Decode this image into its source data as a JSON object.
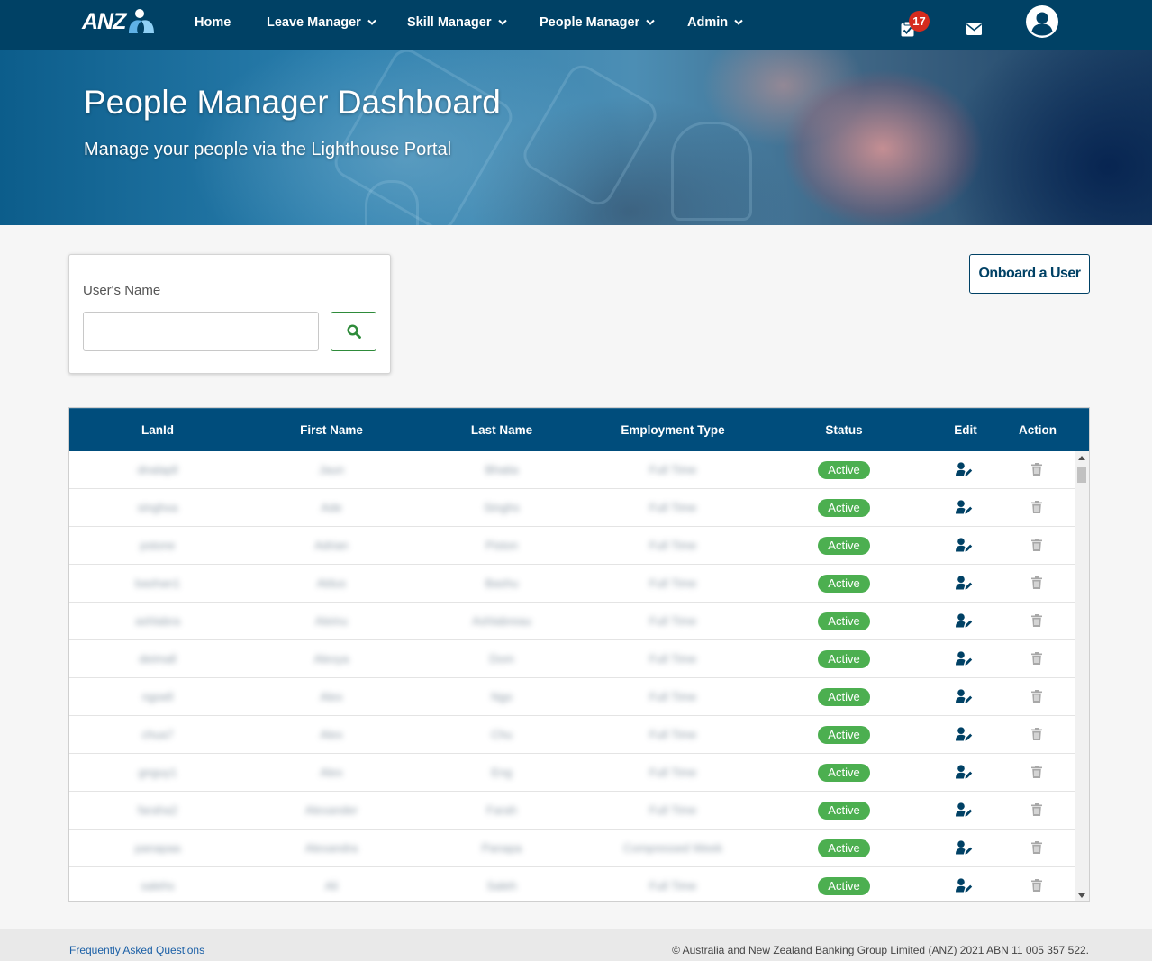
{
  "nav": {
    "logo_text": "ANZ",
    "items": [
      {
        "label": "Home",
        "has_dropdown": false
      },
      {
        "label": "Leave Manager",
        "has_dropdown": true
      },
      {
        "label": "Skill Manager",
        "has_dropdown": true
      },
      {
        "label": "People Manager",
        "has_dropdown": true
      },
      {
        "label": "Admin",
        "has_dropdown": true
      }
    ],
    "tasks_icon": "clipboard-check-icon",
    "tasks_badge": "17",
    "mail_icon": "envelope-icon",
    "profile_icon": "user-circle-icon"
  },
  "hero": {
    "title": "People Manager Dashboard",
    "subtitle": "Manage your people via the Lighthouse Portal"
  },
  "search": {
    "label": "User's Name",
    "value": "",
    "button_icon": "search-icon"
  },
  "onboard_label": "Onboard a User",
  "table": {
    "columns": [
      "LanId",
      "First Name",
      "Last Name",
      "Employment Type",
      "Status",
      "Edit",
      "Action"
    ],
    "rows": [
      {
        "lanid": "dnalapll",
        "first": "Jaun",
        "last": "Bhatia",
        "type": "Full Time",
        "status": "Active"
      },
      {
        "lanid": "singhxa",
        "first": "Ade",
        "last": "Singhs",
        "type": "Full Time",
        "status": "Active"
      },
      {
        "lanid": "pstone",
        "first": "Adrian",
        "last": "Piston",
        "type": "Full Time",
        "status": "Active"
      },
      {
        "lanid": "bashan1",
        "first": "Aldus",
        "last": "Bashu",
        "type": "Full Time",
        "status": "Active"
      },
      {
        "lanid": "ashlabra",
        "first": "Aleinu",
        "last": "Ashlabreau",
        "type": "Full Time",
        "status": "Active"
      },
      {
        "lanid": "deimall",
        "first": "Alexya",
        "last": "Dom",
        "type": "Full Time",
        "status": "Active"
      },
      {
        "lanid": "ngoell",
        "first": "Alex",
        "last": "Ngo",
        "type": "Full Time",
        "status": "Active"
      },
      {
        "lanid": "chua7",
        "first": "Alex",
        "last": "Chu",
        "type": "Full Time",
        "status": "Active"
      },
      {
        "lanid": "gnguy1",
        "first": "Alex",
        "last": "Eng",
        "type": "Full Time",
        "status": "Active"
      },
      {
        "lanid": "faraha2",
        "first": "Alexander",
        "last": "Farah",
        "type": "Full Time",
        "status": "Active"
      },
      {
        "lanid": "panapaa",
        "first": "Alexandra",
        "last": "Panapa",
        "type": "Compressed Week",
        "status": "Active"
      },
      {
        "lanid": "salehs",
        "first": "Ali",
        "last": "Saleh",
        "type": "Full Time",
        "status": "Active"
      }
    ],
    "edit_icon": "user-edit-icon",
    "delete_icon": "trash-icon"
  },
  "footer": {
    "faq": "Frequently Asked Questions",
    "copyright": "© Australia and New Zealand Banking Group Limited (ANZ) 2021 ABN 11 005 357 522."
  },
  "colors": {
    "navbar": "#004165",
    "table_header": "#004d7c",
    "status_active": "#4caf50",
    "badge": "#d52b1e",
    "search_button_border": "#2e8b3a"
  }
}
